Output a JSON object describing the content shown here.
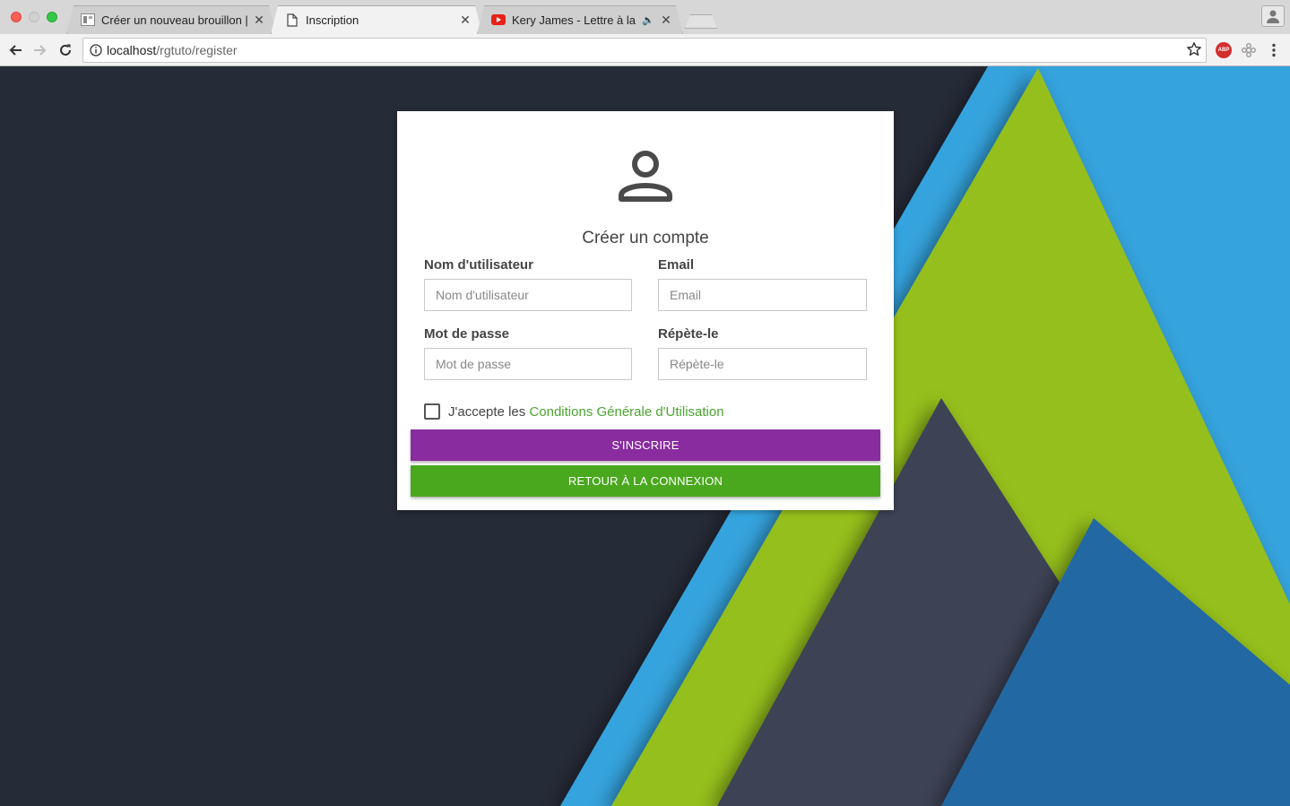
{
  "browser": {
    "tabs": [
      {
        "title": "Créer un nouveau brouillon | R",
        "favicon": "page-favicon-icon",
        "active": false
      },
      {
        "title": "Inscription",
        "favicon": "document-icon",
        "active": true
      },
      {
        "title": "Kery James - Lettre à la Ré",
        "favicon": "youtube-icon",
        "active": false,
        "audio": "🔈"
      }
    ],
    "close_glyph": "✕",
    "url_host": "localhost",
    "url_path": "/rgtuto/register",
    "extension_abp_label": "ABP"
  },
  "form": {
    "title": "Créer un compte",
    "username": {
      "label": "Nom d'utilisateur",
      "placeholder": "Nom d'utilisateur",
      "value": ""
    },
    "email": {
      "label": "Email",
      "placeholder": "Email",
      "value": ""
    },
    "password": {
      "label": "Mot de passe",
      "placeholder": "Mot de passe",
      "value": ""
    },
    "repeat": {
      "label": "Répète-le",
      "placeholder": "Répète-le",
      "value": ""
    },
    "terms_prefix": "J'accepte les ",
    "terms_link": "Conditions Générale d'Utilisation",
    "terms_checked": false,
    "register_button": "S'INSCRIRE",
    "back_button": "RETOUR À LA CONNEXION"
  },
  "colors": {
    "background": "#262b38",
    "register_button": "#892c9f",
    "back_button": "#4aa81e",
    "link": "#4aa52e",
    "art_blue": "#36a3dd",
    "art_green": "#95bf1f",
    "art_slate": "#3c4354",
    "art_dark_blue": "#2268a2"
  }
}
